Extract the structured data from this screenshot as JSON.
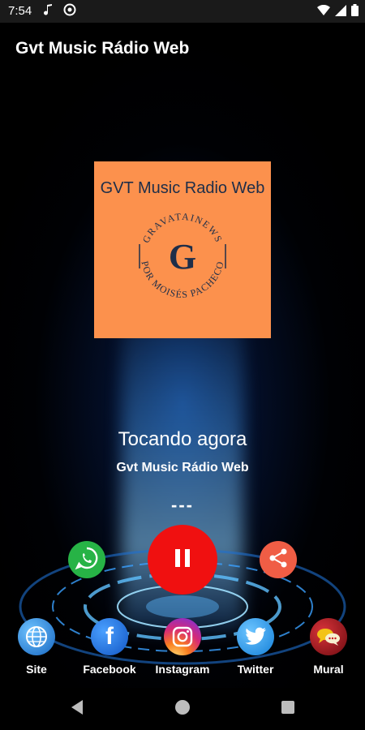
{
  "status_bar": {
    "time": "7:54",
    "icons": [
      "music-note-icon",
      "circle-badge-icon",
      "wifi-icon",
      "signal-icon",
      "battery-icon"
    ]
  },
  "app_bar": {
    "title": "Gvt Music Rádio Web"
  },
  "cover_art": {
    "title": "GVT Music Radio Web",
    "seal_top_text": "GRAVATAINEWS",
    "seal_bottom_text": "POR MOISÉS PACHECO",
    "seal_letter": "G",
    "bg_color": "#fc914d",
    "ink_color": "#1e2e49"
  },
  "player": {
    "now_playing_label": "Tocando agora",
    "station": "Gvt Music Rádio Web",
    "track": "---",
    "buttons": [
      {
        "name": "whatsapp",
        "icon": "whatsapp-icon",
        "color": "#27b346"
      },
      {
        "name": "pause",
        "icon": "pause-icon",
        "color": "#f01010"
      },
      {
        "name": "share",
        "icon": "share-icon",
        "color": "#f05d45"
      }
    ]
  },
  "bottom_menu": [
    {
      "label": "Site",
      "icon": "globe-icon",
      "color": "#2a8fe0"
    },
    {
      "label": "Facebook",
      "icon": "facebook-icon",
      "color": "#1877f2"
    },
    {
      "label": "Instagram",
      "icon": "instagram-icon",
      "color": "#d62976"
    },
    {
      "label": "Twitter",
      "icon": "twitter-icon",
      "color": "#1da1f2"
    },
    {
      "label": "Mural",
      "icon": "chat-bubbles-icon",
      "color": "#a0121a"
    }
  ],
  "system_nav": [
    "back-icon",
    "home-icon",
    "recents-icon"
  ]
}
